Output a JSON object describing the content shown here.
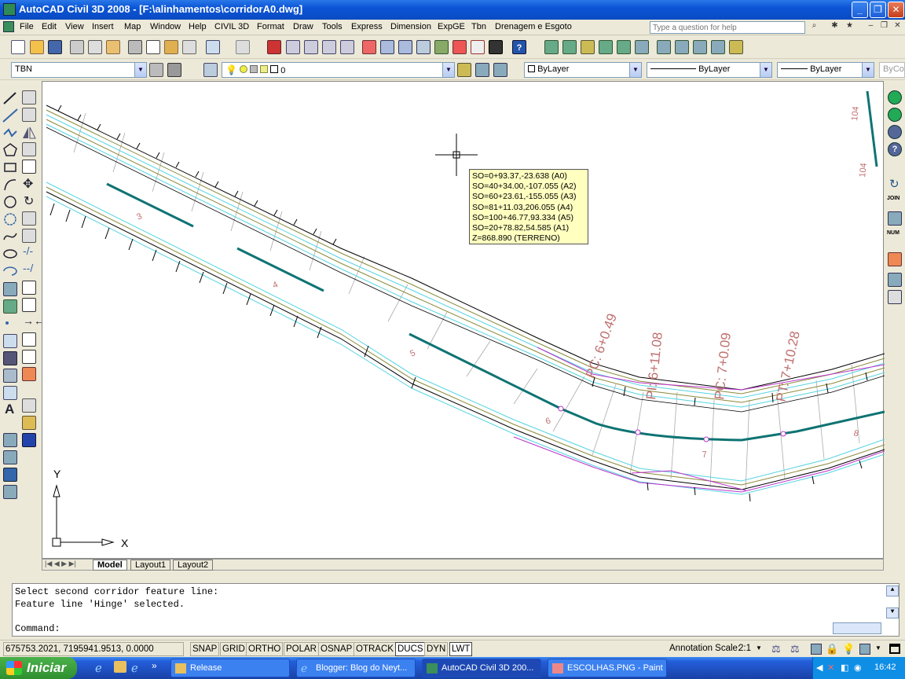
{
  "window": {
    "title": "AutoCAD Civil 3D 2008 - [F:\\alinhamentos\\corridorA0.dwg]"
  },
  "menu": [
    "File",
    "Edit",
    "View",
    "Insert",
    "Map",
    "Window",
    "Help",
    "CIVIL 3D",
    "Format",
    "Draw",
    "Tools",
    "Express",
    "Dimension",
    "ExpGE",
    "Tbn",
    "Drenagem e Esgoto"
  ],
  "help_search": {
    "placeholder": "Type a question for help"
  },
  "properties": {
    "text_style": "TBN",
    "layer": "0",
    "color": "ByLayer",
    "linetype": "ByLayer",
    "lineweight": "ByLayer",
    "plotstyle": "ByCo"
  },
  "tooltip": {
    "lines": [
      "SO=0+93.37,-23.638 (A0)",
      "SO=40+34.00,-107.055 (A2)",
      "SO=60+23.61,-155.055 (A3)",
      "SO=81+11.03,206.055 (A4)",
      "SO=100+46.77,93.334 (A5)",
      "SO=20+78.82,54.585 (A1)",
      "Z=868.890 (TERRENO)"
    ]
  },
  "drawing": {
    "station_numbers": [
      "3",
      "4",
      "5",
      "6",
      "7",
      "8"
    ],
    "curve_labels": [
      "PC: 6+0.49",
      "PI: 6+11.08",
      "PC: 7+0.09",
      "PT: 7+10.28"
    ],
    "corner_labels": [
      "104",
      "104"
    ],
    "ucs": {
      "y": "Y",
      "x": "X"
    },
    "colors": {
      "alignment": "#0f7373",
      "edge": "#55d4e0",
      "terrain": "#bb33cc",
      "offset": "#8a8a3a"
    }
  },
  "tabs": [
    "Model",
    "Layout1",
    "Layout2"
  ],
  "command": {
    "lines": [
      "Select second corridor feature line:",
      "Feature line 'Hinge' selected."
    ],
    "prompt": "Command:"
  },
  "status": {
    "coords": "675753.2021, 7195941.9513, 0.0000",
    "toggles": [
      "SNAP",
      "GRID",
      "ORTHO",
      "POLAR",
      "OSNAP",
      "OTRACK",
      "DUCS",
      "DYN",
      "LWT"
    ],
    "active_toggles": [
      "DUCS",
      "LWT"
    ],
    "annotation_label": "Annotation Scale:",
    "annotation_scale": "2:1"
  },
  "taskbar": {
    "start": "Iniciar",
    "buttons": [
      "Release",
      "Blogger: Blog do Neyt...",
      "AutoCAD Civil 3D 200...",
      "ESCOLHAS.PNG - Paint"
    ],
    "active_button": "AutoCAD Civil 3D 200...",
    "clock": "16:42"
  }
}
